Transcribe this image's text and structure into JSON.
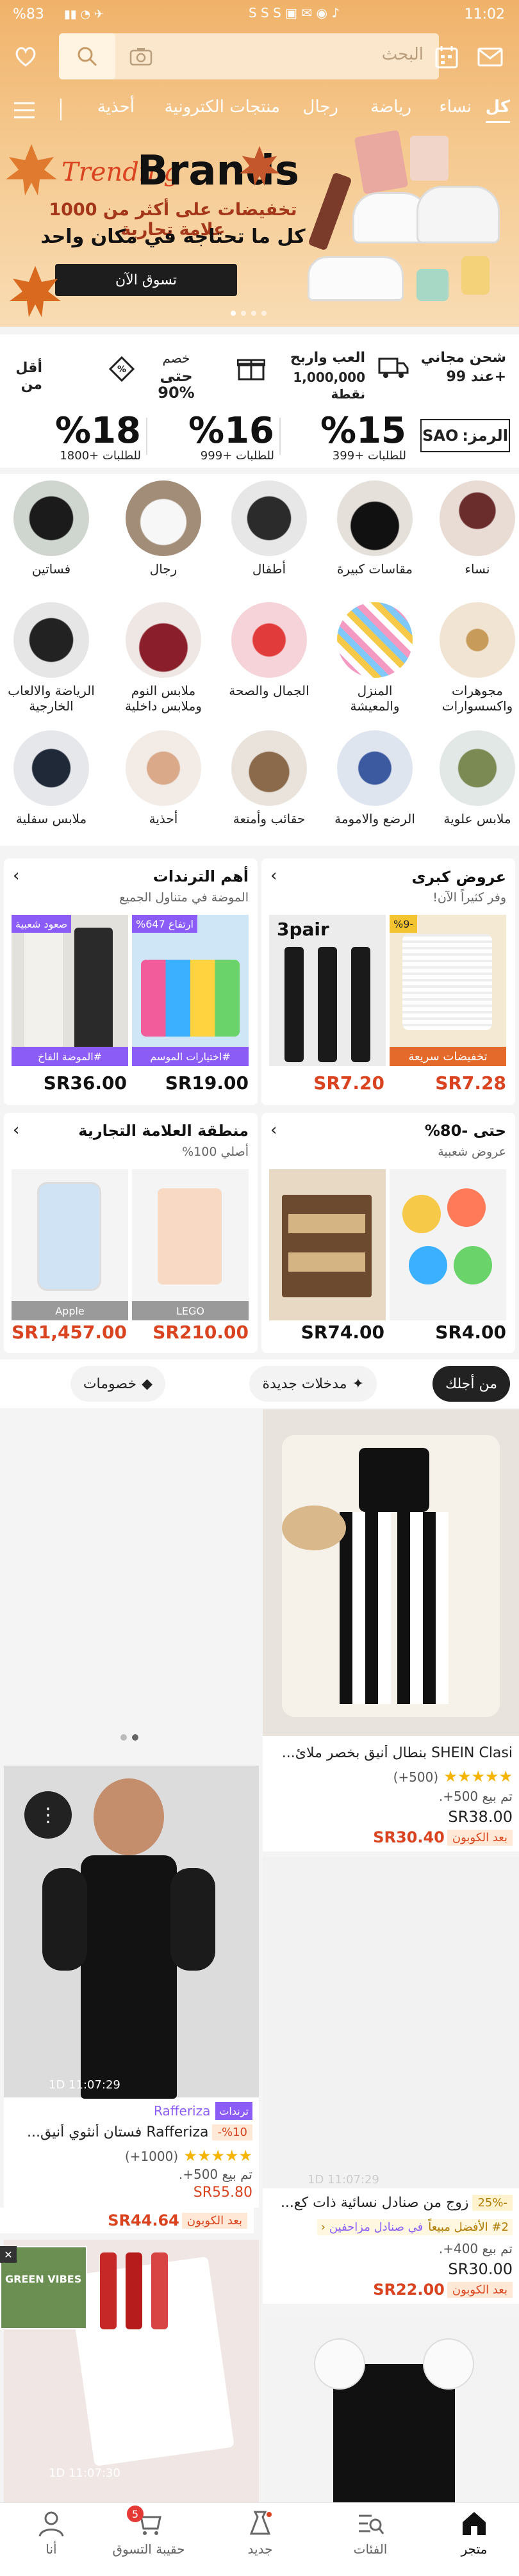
{
  "status_bar": {
    "time": "11:02",
    "battery": "%83"
  },
  "header": {
    "search_placeholder": "البحث",
    "categories": [
      "كل",
      "نساء",
      "رياضة",
      "رجال",
      "منتجات الكترونية",
      "أحذية"
    ]
  },
  "banner": {
    "script_text": "Trending",
    "brand_text": "Brands",
    "headline": "تخفيضات على أكثر من 1000 علامة تجارية",
    "subline": "كل ما تحتاجه في مكان واحد",
    "button": "تسوق الآن"
  },
  "benefits": [
    {
      "line1": "شحن مجاني",
      "line2": "عند 99+"
    },
    {
      "line1": "العب واربح",
      "line2": "1,000,000 نقطة"
    },
    {
      "line1": "خصم",
      "line2": "حتى 90%"
    },
    {
      "line1": "أقل من",
      "line2": ""
    }
  ],
  "coupons": {
    "code_label": "الرمز:",
    "code": "SAO",
    "items": [
      {
        "pct": "%15",
        "cond": "للطلبات +399"
      },
      {
        "pct": "%16",
        "cond": "للطلبات +999"
      },
      {
        "pct": "%18",
        "cond": "للطلبات +1800"
      }
    ]
  },
  "category_grid": [
    [
      "نساء",
      "مقاسات كبيرة",
      "أطفال",
      "رجال",
      "فساتين"
    ],
    [
      "مجوهرات واكسسوارات",
      "المنزل والمعيشة",
      "الجمال والصحة",
      "ملابس النوم وملابس داخلية",
      "الرياضة والالعاب الخارجية"
    ],
    [
      "ملابس علوية",
      "الرضع والامومة",
      "حقائب وأمتعة",
      "أحذية",
      "ملابس سفلية"
    ]
  ],
  "promo_cards": [
    {
      "title": "عروض كبرى",
      "subtitle": "وفر كثيراً الآن!",
      "items": [
        {
          "badge": "%9-",
          "label": "تخفيضات سريعة",
          "price": "SR7.28",
          "red": true
        },
        {
          "badge": "",
          "label": "3pair",
          "price": "SR7.20",
          "red": true
        }
      ]
    },
    {
      "title": "أهم الترندات",
      "subtitle": "الموضة في متناول الجميع",
      "items": [
        {
          "badge": "ارتفاع 647%",
          "label": "#اختيارات الموسم",
          "price": "SR19.00",
          "red": false
        },
        {
          "badge": "صعود شعبية",
          "label": "#الموضة الفاخ",
          "price": "SR36.00",
          "red": false
        }
      ]
    },
    {
      "title": "حتى -80%",
      "subtitle": "عروض شعبية",
      "items": [
        {
          "badge": "",
          "label": "",
          "price": "SR4.00",
          "red": false
        },
        {
          "badge": "",
          "label": "",
          "price": "SR74.00",
          "red": false
        }
      ]
    },
    {
      "title": "منطقة العلامة التجارية",
      "subtitle": "أصلي 100%",
      "items": [
        {
          "badge": "",
          "label": "LEGO",
          "price": "SR210.00",
          "red": true
        },
        {
          "badge": "",
          "label": "Apple",
          "price": "SR1,457.00",
          "red": true
        }
      ]
    }
  ],
  "tabs": [
    "من أجلك",
    "مدخلات جديدة",
    "خصومات"
  ],
  "products": {
    "p1": {
      "title": "SHEIN Clasi بنطال أنيق بخصر ملائ...",
      "reviews": "(500+)",
      "sold": "تم بيع 500+.",
      "price": "SR38.00",
      "coupon_label": "بعد الكوبون",
      "coupon_price": "SR30.40"
    },
    "p2": {
      "timer": "1D 11:07:29",
      "trend": "ترندات",
      "brand": "Rafferiza",
      "discount": "%10-",
      "title": "Rafferiza فستان أنثوي أنيق...",
      "reviews": "(1000+)",
      "sold": "تم بيع 500+.",
      "price": "SR55.80",
      "coupon_label": "بعد الكوبون",
      "coupon_price": "SR44.64"
    },
    "p3": {
      "timer": "1D 11:07:29",
      "discount": "-25%",
      "title": "زوج من صنادل نسائية ذات كع...",
      "rank": "#2 الأفضل مبيعاً",
      "rank_cat": "في صنادل مزاحفين",
      "sold": "تم بيع 400+.",
      "price": "SR30.00",
      "coupon_label": "بعد الكوبون",
      "coupon_price": "SR22.00"
    },
    "p4": {
      "timer": "1D 11:07:30"
    }
  },
  "floating_ad": {
    "text": "GREEN VIBES"
  },
  "bottom_nav": [
    {
      "label": "متجر",
      "icon": "home-icon",
      "active": true
    },
    {
      "label": "الفئات",
      "icon": "categories-icon",
      "active": false
    },
    {
      "label": "جديد",
      "icon": "new-icon",
      "active": false
    },
    {
      "label": "حقيبة التسوق",
      "icon": "cart-icon",
      "active": false,
      "badge": "5"
    },
    {
      "label": "أنا",
      "icon": "user-icon",
      "active": false
    }
  ],
  "colors": {
    "accent": "#d9431f",
    "gold": "#f4b400",
    "purple": "#8b5cf6"
  }
}
